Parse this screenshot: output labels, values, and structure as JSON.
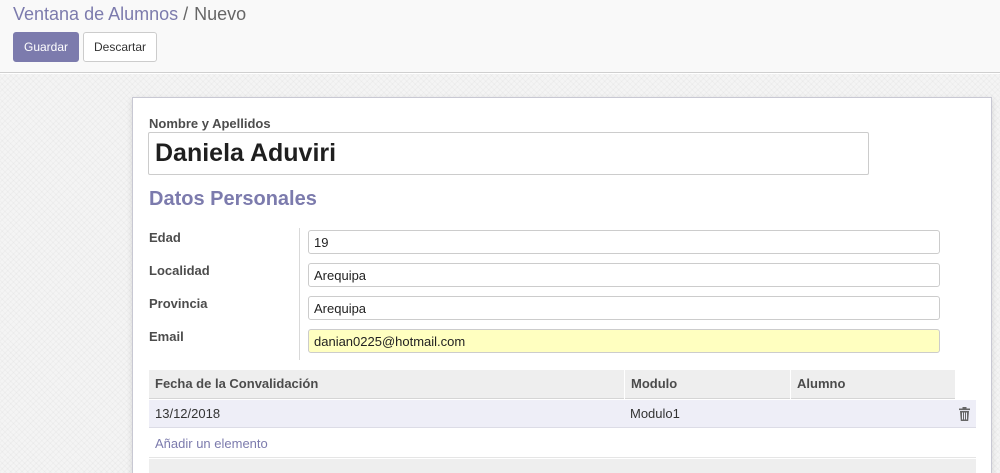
{
  "breadcrumb": {
    "parent": "Ventana de Alumnos",
    "separator": "/",
    "current": "Nuevo"
  },
  "toolbar": {
    "save_label": "Guardar",
    "discard_label": "Descartar"
  },
  "form": {
    "name_label": "Nombre y Apellidos",
    "name_value": "Daniela Aduviri",
    "section_title": "Datos Personales",
    "fields": [
      {
        "label": "Edad",
        "value": "19"
      },
      {
        "label": "Localidad",
        "value": "Arequipa"
      },
      {
        "label": "Provincia",
        "value": "Arequipa"
      },
      {
        "label": "Email",
        "value": "danian0225@hotmail.com"
      }
    ]
  },
  "table": {
    "columns": [
      "Fecha de la Convalidación",
      "Modulo",
      "Alumno"
    ],
    "rows": [
      {
        "fecha": "13/12/2018",
        "modulo": "Modulo1",
        "alumno": ""
      }
    ],
    "add_label": "Añadir un elemento"
  },
  "colors": {
    "accent": "#7c7bad",
    "required_field_bg": "#ffffc0"
  },
  "icons": {
    "row_delete": "trash-icon"
  }
}
